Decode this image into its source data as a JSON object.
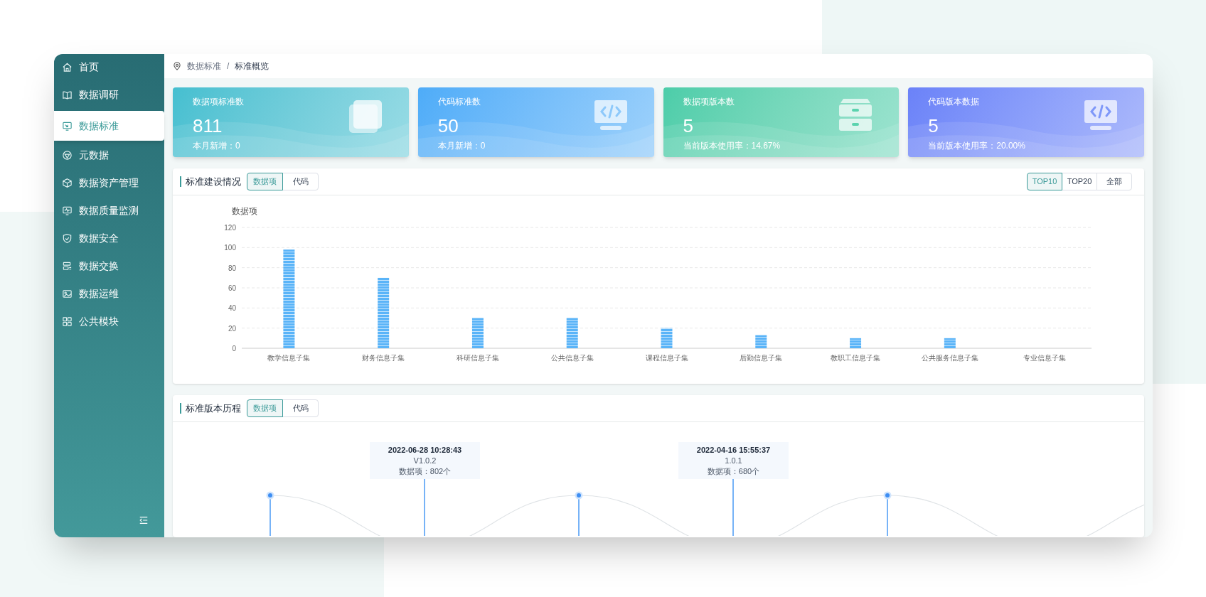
{
  "sidebar": {
    "items": [
      {
        "label": "首页",
        "selected": false
      },
      {
        "label": "数据调研",
        "selected": false
      },
      {
        "label": "数据标准",
        "selected": true
      },
      {
        "label": "元数据",
        "selected": false
      },
      {
        "label": "数据资产管理",
        "selected": false
      },
      {
        "label": "数据质量监测",
        "selected": false
      },
      {
        "label": "数据安全",
        "selected": false
      },
      {
        "label": "数据交换",
        "selected": false
      },
      {
        "label": "数据运维",
        "selected": false
      },
      {
        "label": "公共模块",
        "selected": false
      }
    ]
  },
  "breadcrumb": {
    "items": [
      "数据标准",
      "标准概览"
    ],
    "separator": "/"
  },
  "cards": [
    {
      "title": "数据项标准数",
      "value": "811",
      "sub": "本月新增：0",
      "color": "#45bfd0"
    },
    {
      "title": "代码标准数",
      "value": "50",
      "sub": "本月新增：0",
      "color": "#4eacf8"
    },
    {
      "title": "数据项版本数",
      "value": "5",
      "sub": "当前版本使用率：14.67%",
      "color": "#4ccda9"
    },
    {
      "title": "代码版本数据",
      "value": "5",
      "sub": "当前版本使用率：20.00%",
      "color": "#6b82f8"
    }
  ],
  "build_panel": {
    "title": "标准建设情况",
    "tabs": [
      {
        "label": "数据项",
        "selected": true
      },
      {
        "label": "代码",
        "selected": false
      }
    ],
    "range_tabs": [
      {
        "label": "TOP10",
        "selected": true
      },
      {
        "label": "TOP20",
        "selected": false
      },
      {
        "label": "全部",
        "selected": false
      }
    ],
    "chart_data": {
      "type": "bar",
      "ylabel": "数据项",
      "categories": [
        "教学信息子集",
        "财务信息子集",
        "科研信息子集",
        "公共信息子集",
        "课程信息子集",
        "后勤信息子集",
        "教职工信息子集",
        "公共服务信息子集",
        "专业信息子集"
      ],
      "values": [
        98,
        70,
        30,
        30,
        20,
        13,
        10,
        10,
        0
      ],
      "grid": true,
      "ylim": [
        0,
        120
      ],
      "yticks": [
        0,
        20,
        40,
        60,
        80,
        100,
        120
      ]
    }
  },
  "version_panel": {
    "title": "标准版本历程",
    "tabs": [
      {
        "label": "数据项",
        "selected": true
      },
      {
        "label": "代码",
        "selected": false
      }
    ],
    "versions": [
      {
        "date": "2022-06-28 10:28:43",
        "version": "V1.0.2",
        "count": "数据项：802个"
      },
      {
        "date": "2022-04-16 15:55:37",
        "version": "1.0.1",
        "count": "数据项：680个"
      }
    ]
  }
}
